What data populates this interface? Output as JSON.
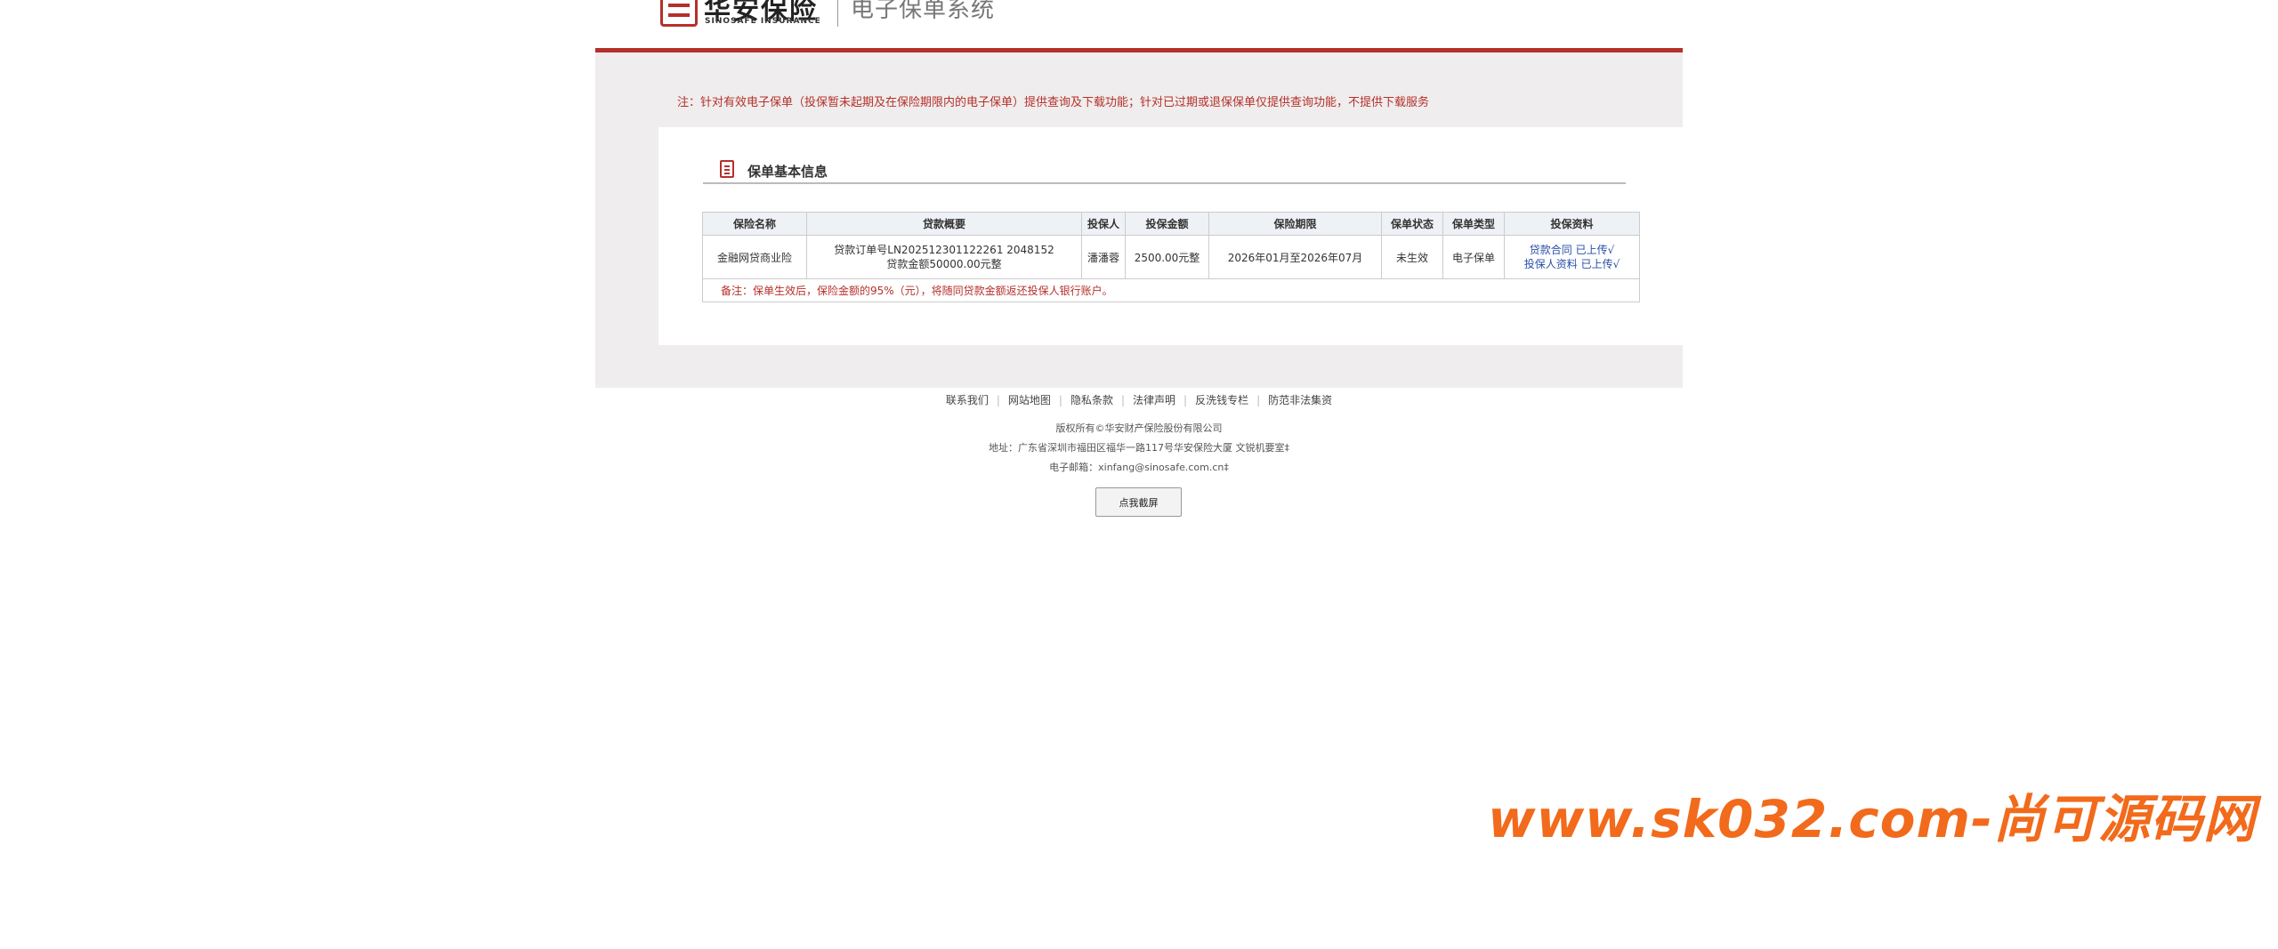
{
  "header": {
    "logo_cn": "华安保险",
    "logo_en": "SINOSAFE INSURANCE",
    "system_title": "电子保单系统"
  },
  "notice": "注：针对有效电子保单（投保暂未起期及在保险期限内的电子保单）提供查询及下载功能；针对已过期或退保保单仅提供查询功能，不提供下载服务",
  "section": {
    "title": "保单基本信息"
  },
  "table": {
    "headers": [
      "保险名称",
      "贷款概要",
      "投保人",
      "投保金额",
      "保险期限",
      "保单状态",
      "保单类型",
      "投保资料"
    ],
    "row": {
      "insurance_name": "金融网贷商业险",
      "loan_order": "贷款订单号LN202512301122261 2048152",
      "loan_amount": "贷款金额50000.00元整",
      "applicant": "潘潘蓉",
      "insured_amount": "2500.00元整",
      "period": "2026年01月至2026年07月",
      "status": "未生效",
      "policy_type": "电子保单",
      "material_1": "贷款合同 已上传√",
      "material_2": "投保人资料 已上传√"
    },
    "note": "备注：保单生效后，保险金额的95%（元），将随同贷款金额返还投保人银行账户。"
  },
  "footer": {
    "nav": [
      "联系我们",
      "网站地图",
      "隐私条款",
      "法律声明",
      "反洗钱专栏",
      "防范非法集资"
    ],
    "copyright": "版权所有©华安财产保险股份有限公司",
    "address": "地址：广东省深圳市福田区福华一路117号华安保险大厦 文锐机要室‡",
    "email": "电子邮箱：xinfang@sinosafe.com.cn‡",
    "snapshot_button": "点我截屏"
  },
  "watermark": "www.sk032.com-尚可源码网",
  "colors": {
    "brand_red": "#b5302a",
    "link_blue": "#2a4fa8",
    "watermark_orange": "#f26a1b"
  }
}
